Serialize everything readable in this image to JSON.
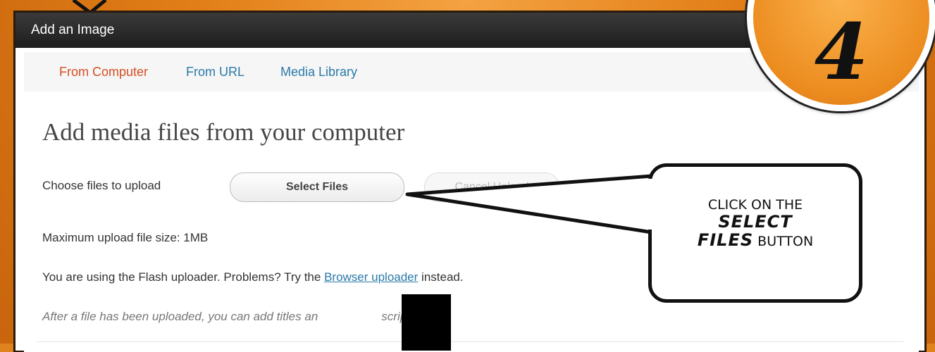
{
  "dialog": {
    "title": "Add an Image",
    "tabs": [
      {
        "label": "From Computer",
        "active": true
      },
      {
        "label": "From URL",
        "active": false
      },
      {
        "label": "Media Library",
        "active": false
      }
    ],
    "heading": "Add media files from your computer",
    "choose_label": "Choose files to upload",
    "select_button": "Select Files",
    "cancel_button": "Cancel Upload",
    "max_size": "Maximum upload file size: 1MB",
    "flash_text_before": "You are using the Flash uploader. Problems? Try the ",
    "flash_link": "Browser uploader",
    "flash_text_after": " instead.",
    "after_upload_before": "After a file has been uploaded, you can add titles an",
    "after_upload_after": "scriptions."
  },
  "callout": {
    "line1": "Click on the",
    "bold1": "Select",
    "bold2": "Files",
    "line3": "button"
  },
  "step_badge": {
    "number": "4"
  },
  "colors": {
    "background": "#e0831d",
    "tab_active": "#d54e21",
    "link": "#2a7aa8"
  }
}
